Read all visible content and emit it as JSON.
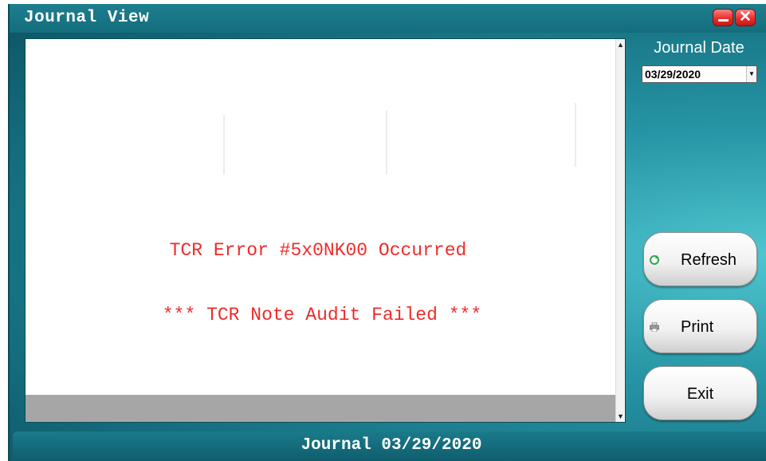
{
  "window": {
    "title": "Journal View",
    "minimize_icon": "minimize-icon",
    "close_glyph": "✕"
  },
  "journal": {
    "lines": [
      "TCR Error #5x0NK00 Occurred",
      "*** TCR Note Audit Failed ***"
    ],
    "error_color": "#ee2b2b"
  },
  "date_picker": {
    "label": "Journal Date",
    "value": "03/29/2020"
  },
  "actions": {
    "refresh_label": "Refresh",
    "refresh_icon": "refresh-icon",
    "print_label": "Print",
    "print_icon": "printer-icon",
    "exit_label": "Exit"
  },
  "status": {
    "text": "Journal 03/29/2020"
  },
  "colors": {
    "window_teal": "#146d7d",
    "close_red": "#e5302c"
  }
}
